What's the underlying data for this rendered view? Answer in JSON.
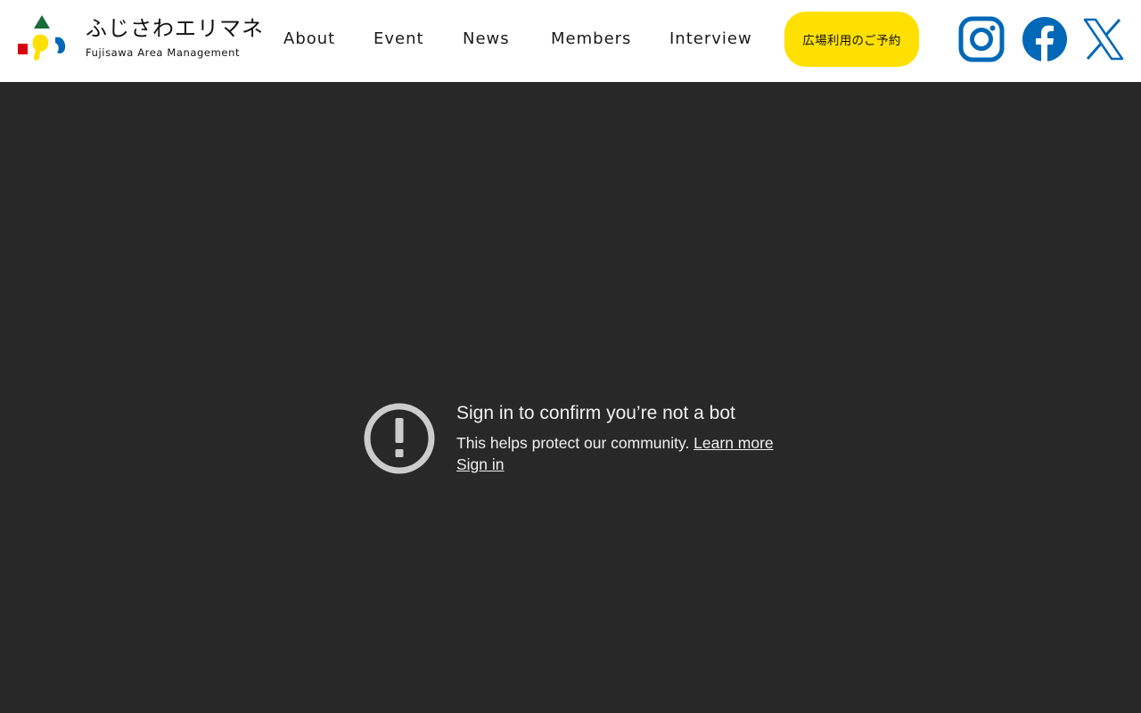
{
  "header": {
    "logo": {
      "title_jp": "ふじさわエリマネ",
      "title_en": "Fujisawa Area Management"
    },
    "nav": [
      {
        "label": "About"
      },
      {
        "label": "Event"
      },
      {
        "label": "News"
      },
      {
        "label": "Members"
      },
      {
        "label": "Interview"
      }
    ],
    "reserve_button": "広場利用のご予約",
    "social": [
      {
        "icon": "instagram-icon"
      },
      {
        "icon": "facebook-icon"
      },
      {
        "icon": "x-icon"
      }
    ]
  },
  "video_notice": {
    "icon": "alert-circle-icon",
    "title": "Sign in to confirm you’re not a bot",
    "message": "This helps protect our community.",
    "learn_more": "Learn more",
    "sign_in": "Sign in"
  },
  "colors": {
    "header_bg": "#ffffff",
    "accent_yellow": "#ffe000",
    "social_blue": "#0068b7",
    "video_bg": "#282828",
    "notice_text": "#f1f1f1",
    "alert_icon": "#cccccc",
    "logo_green": "#1a6b3a",
    "logo_red": "#d7000f",
    "logo_yellow": "#ffe000",
    "logo_blue": "#0068b7"
  }
}
